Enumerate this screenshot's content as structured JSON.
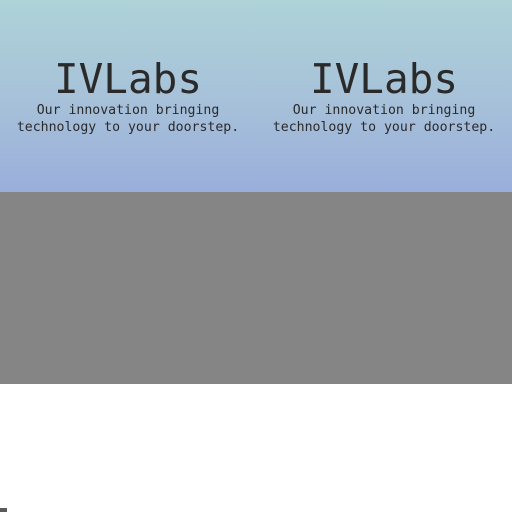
{
  "hero": {
    "blocks": [
      {
        "title": "IVLabs",
        "tagline": "Our innovation bringing\ntechnology to your doorstep."
      },
      {
        "title": "IVLabs",
        "tagline": "Our innovation bringing\ntechnology to your doorstep."
      }
    ]
  }
}
